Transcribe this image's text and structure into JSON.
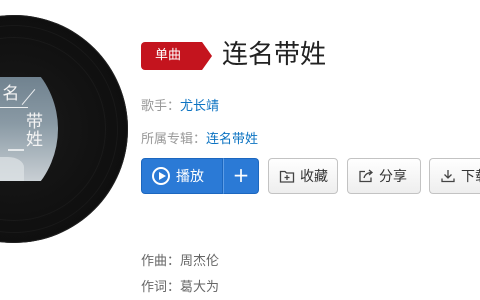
{
  "song": {
    "badge": "单曲",
    "title": "连名带姓"
  },
  "meta": {
    "singer_label": "歌手：",
    "singer": "尤长靖",
    "album_label": "所属专辑：",
    "album": "连名带姓"
  },
  "cover": {
    "text_top": "连 名",
    "text_side": "带姓"
  },
  "buttons": {
    "play": "播放",
    "add": "+",
    "collect": "收藏",
    "share": "分享",
    "download": "下载"
  },
  "credits": {
    "composer": "作曲：周杰伦",
    "lyricist": "作词：葛大为"
  },
  "colors": {
    "badge": "#c4141e",
    "play_button": "#2b7ad6",
    "link": "#0c73c2"
  },
  "icons": {
    "play": "play-circle-icon",
    "collect": "folder-plus-icon",
    "share": "share-icon",
    "download": "download-icon"
  }
}
